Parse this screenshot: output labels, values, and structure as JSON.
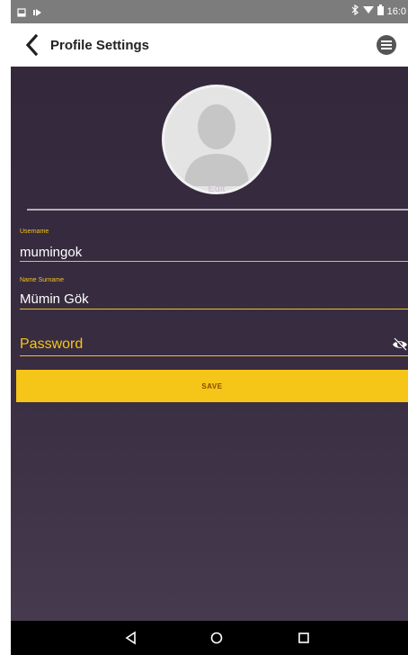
{
  "status_bar": {
    "time": "16:0",
    "icons": [
      "sim-icon",
      "play-store-icon",
      "bluetooth-icon",
      "wifi-icon",
      "battery-icon"
    ]
  },
  "app_bar": {
    "title": "Profile Settings",
    "back_icon": "chevron-left-icon",
    "menu_icon": "menu-circle-icon"
  },
  "profile": {
    "avatar_icon": "default-user-avatar",
    "edit_label": "Edit"
  },
  "form": {
    "username_label": "Username",
    "username_value": "mumingok",
    "name_label": "Name Surname",
    "name_value": "Mümin Gök",
    "password_placeholder": "Password",
    "password_toggle_icon": "eye-off-icon",
    "save_label": "SAVE"
  },
  "nav_bar": {
    "back_icon": "triangle-back-icon",
    "home_icon": "circle-home-icon",
    "recents_icon": "square-recents-icon"
  },
  "colors": {
    "accent": "#f5c518",
    "background_top": "#34293c",
    "background_bottom": "#463a4e",
    "status_bar": "#7c7c7c",
    "nav_bar": "#000000"
  }
}
